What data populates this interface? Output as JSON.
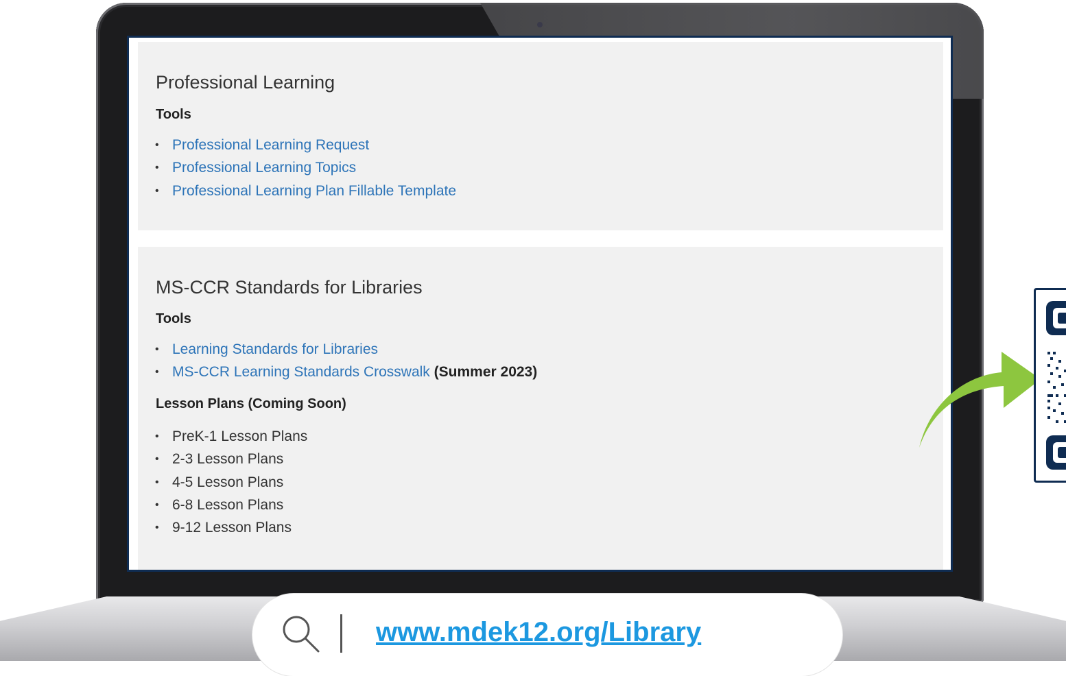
{
  "section1": {
    "title": "Professional Learning",
    "tools_heading": "Tools",
    "links": [
      "Professional Learning Request",
      "Professional Learning Topics",
      "Professional Learning Plan Fillable Template"
    ]
  },
  "section2": {
    "title": "MS-CCR Standards for Libraries",
    "tools_heading": "Tools",
    "links": [
      "Learning Standards for Libraries",
      "MS-CCR Learning Standards Crosswalk"
    ],
    "crosswalk_note": "(Summer 2023)",
    "lesson_heading": "Lesson Plans (Coming Soon)",
    "lesson_plans": [
      "PreK-1 Lesson Plans",
      "2-3 Lesson Plans",
      "4-5 Lesson Plans",
      "6-8 Lesson Plans",
      "9-12 Lesson Plans"
    ]
  },
  "search": {
    "url": "www.mdek12.org/Library",
    "icon": "search-icon"
  },
  "colors": {
    "link": "#2d74b8",
    "url": "#1c98e0",
    "arrow": "#8dc63f",
    "qr_frame": "#0f2c52",
    "panel_bg": "#f1f1f1"
  }
}
